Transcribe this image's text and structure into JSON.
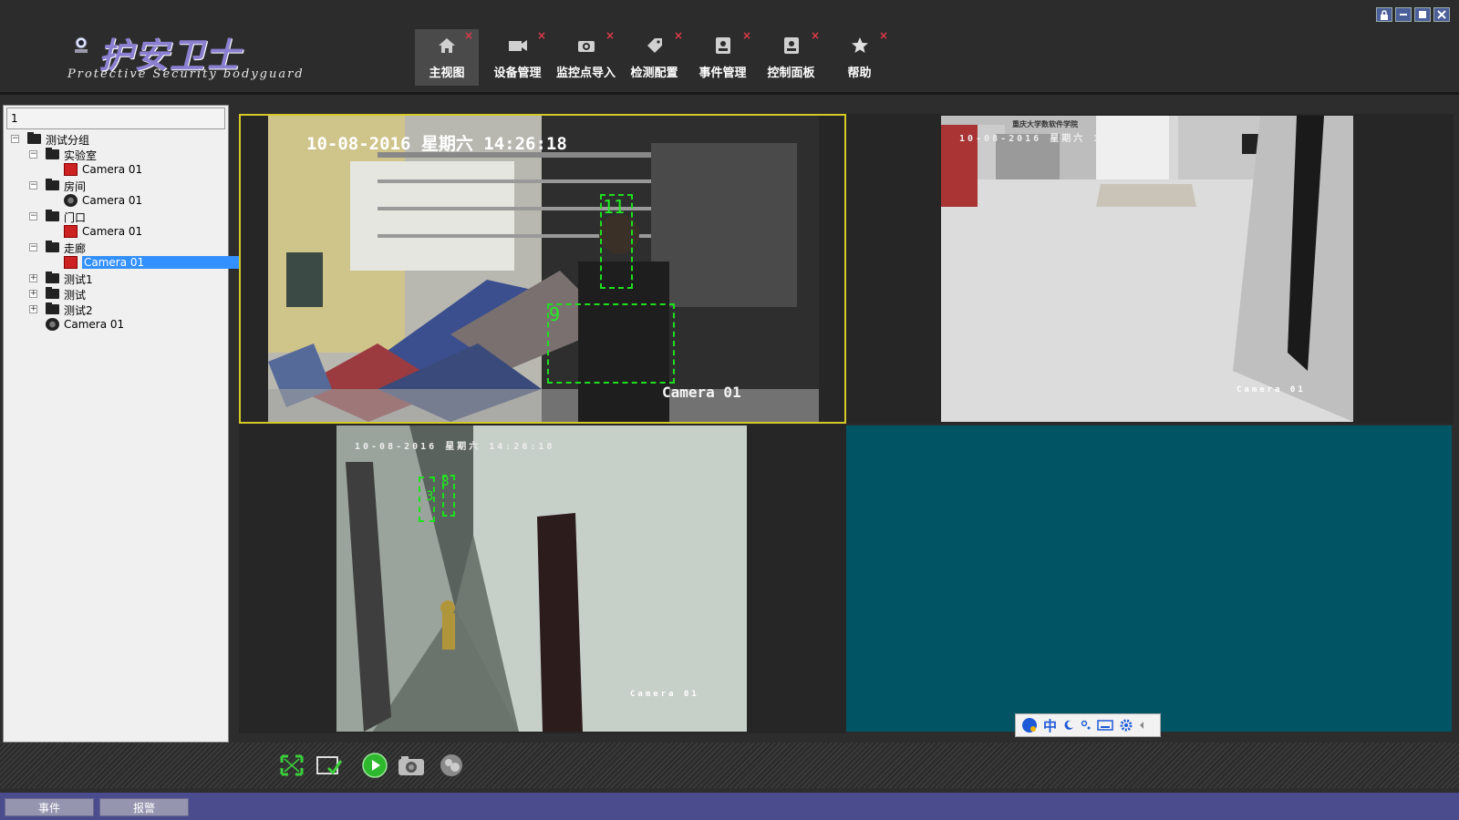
{
  "app": {
    "logo_title": "护安卫士",
    "logo_subtitle": "Protective Security bodyguard"
  },
  "toolbar": {
    "items": [
      {
        "label": "主视图",
        "icon": "home-icon",
        "close": "×"
      },
      {
        "label": "设备管理",
        "icon": "camera-device-icon",
        "close": "×"
      },
      {
        "label": "监控点导入",
        "icon": "camera-import-icon",
        "close": "×"
      },
      {
        "label": "检测配置",
        "icon": "tag-icon",
        "close": "×"
      },
      {
        "label": "事件管理",
        "icon": "event-icon",
        "close": "×"
      },
      {
        "label": "控制面板",
        "icon": "control-panel-icon",
        "close": "×"
      },
      {
        "label": "帮助",
        "icon": "star-icon",
        "close": "×"
      }
    ]
  },
  "window_controls": [
    "lock-icon",
    "minimize-icon",
    "maximize-icon",
    "close-icon"
  ],
  "tree": {
    "search_value": "1",
    "expander_minus": "−",
    "expander_plus": "+",
    "nodes": [
      {
        "label": "测试分组",
        "level": 0,
        "type": "folder",
        "expanded": true
      },
      {
        "label": "实验室",
        "level": 1,
        "type": "folder",
        "expanded": true
      },
      {
        "label": "Camera 01",
        "level": 2,
        "type": "camera-red"
      },
      {
        "label": "房间",
        "level": 1,
        "type": "folder",
        "expanded": true
      },
      {
        "label": "Camera 01",
        "level": 2,
        "type": "camera-round"
      },
      {
        "label": "门口",
        "level": 1,
        "type": "folder",
        "expanded": true
      },
      {
        "label": "Camera 01",
        "level": 2,
        "type": "camera-red"
      },
      {
        "label": "走廊",
        "level": 1,
        "type": "folder",
        "expanded": true
      },
      {
        "label": "Camera 01",
        "level": 2,
        "type": "camera-red",
        "selected": true
      },
      {
        "label": "测试1",
        "level": 1,
        "type": "folder",
        "expanded": false
      },
      {
        "label": "测试",
        "level": 1,
        "type": "folder",
        "expanded": false
      },
      {
        "label": "测试2",
        "level": 1,
        "type": "folder",
        "expanded": false
      },
      {
        "label": "Camera 01",
        "level": 1,
        "type": "camera-round"
      }
    ]
  },
  "videos": {
    "pane1": {
      "timestamp": "10-08-2016 星期六 14:26:18",
      "camera": "Camera 01",
      "detections": [
        "11",
        "9"
      ]
    },
    "pane2": {
      "timestamp": "10-08-2016 星期六 14:26:17",
      "camera": "Camera 01",
      "sign": "重庆大学数软件学院"
    },
    "pane3": {
      "timestamp": "10-08-2016 星期六 14:26:18",
      "camera": "Camera 01",
      "detections": [
        "3",
        "8"
      ]
    },
    "pane4": {
      "color": "#015464"
    }
  },
  "controls": [
    "fullscreen-icon",
    "layout-check-icon",
    "play-icon",
    "snapshot-icon",
    "record-icon"
  ],
  "ime": {
    "mode": "中"
  },
  "bottom_tabs": [
    "事件",
    "报警"
  ]
}
